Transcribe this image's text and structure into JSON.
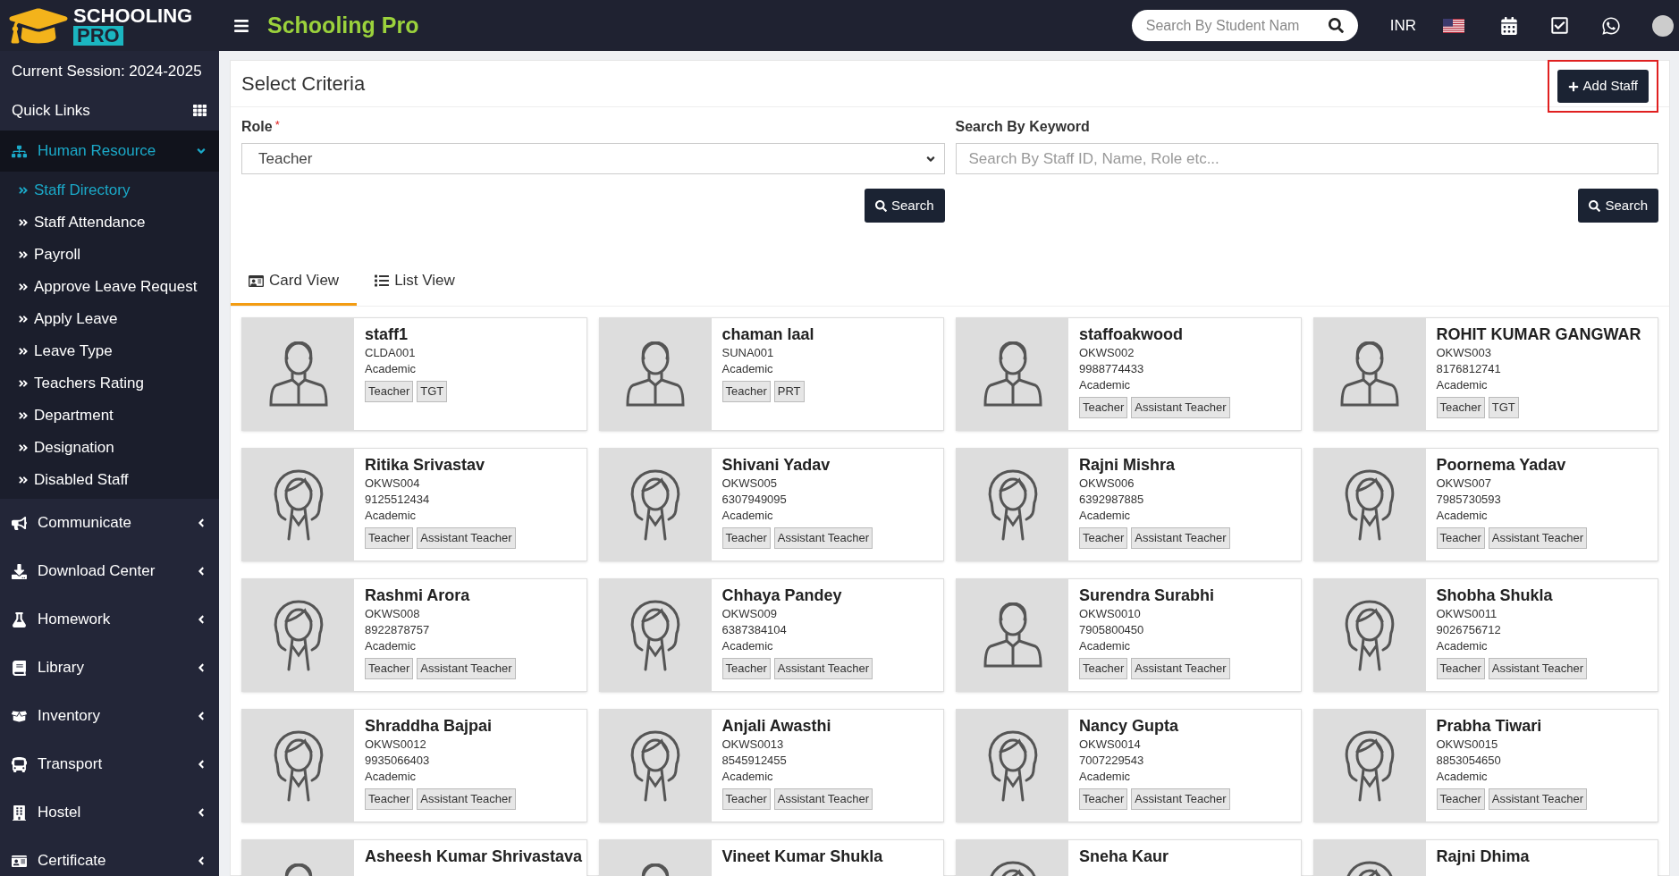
{
  "logo": {
    "top": "SCHOOLING",
    "bottom": "PRO"
  },
  "app_title": "Schooling Pro",
  "search": {
    "placeholder": "Search By Student Nam"
  },
  "currency": "INR",
  "sidebar": {
    "session": "Current Session: 2024-2025",
    "quick_links": "Quick Links",
    "sections": [
      {
        "label": "Human Resource",
        "expanded": true,
        "children": [
          {
            "label": "Staff Directory",
            "selected": true
          },
          {
            "label": "Staff Attendance",
            "selected": false
          },
          {
            "label": "Payroll",
            "selected": false
          },
          {
            "label": "Approve Leave Request",
            "selected": false
          },
          {
            "label": "Apply Leave",
            "selected": false
          },
          {
            "label": "Leave Type",
            "selected": false
          },
          {
            "label": "Teachers Rating",
            "selected": false
          },
          {
            "label": "Department",
            "selected": false
          },
          {
            "label": "Designation",
            "selected": false
          },
          {
            "label": "Disabled Staff",
            "selected": false
          }
        ]
      },
      {
        "label": "Communicate",
        "expanded": false
      },
      {
        "label": "Download Center",
        "expanded": false
      },
      {
        "label": "Homework",
        "expanded": false
      },
      {
        "label": "Library",
        "expanded": false
      },
      {
        "label": "Inventory",
        "expanded": false
      },
      {
        "label": "Transport",
        "expanded": false
      },
      {
        "label": "Hostel",
        "expanded": false
      },
      {
        "label": "Certificate",
        "expanded": false
      }
    ]
  },
  "panel": {
    "title": "Select Criteria",
    "add_button": "Add Staff",
    "role": {
      "label": "Role",
      "required_mark": "*",
      "value": "Teacher"
    },
    "keyword": {
      "label": "Search By Keyword",
      "placeholder": "Search By Staff ID, Name, Role etc..."
    },
    "search_buttons": [
      "Search",
      "Search"
    ],
    "tabs": [
      {
        "label": "Card View",
        "selected": true
      },
      {
        "label": "List View",
        "selected": false
      }
    ],
    "staff": [
      {
        "kind": "male",
        "name": "staff1",
        "lines": [
          "CLDA001",
          "Academic"
        ],
        "tags": [
          "Teacher",
          "TGT"
        ]
      },
      {
        "kind": "male",
        "name": "chaman laal",
        "lines": [
          "SUNA001",
          "Academic"
        ],
        "tags": [
          "Teacher",
          "PRT"
        ]
      },
      {
        "kind": "male",
        "name": "staffoakwood",
        "lines": [
          "OKWS002",
          "9988774433",
          "Academic"
        ],
        "tags": [
          "Teacher",
          "Assistant Teacher"
        ]
      },
      {
        "kind": "male",
        "name": "ROHIT KUMAR GANGWAR",
        "lines": [
          "OKWS003",
          "8176812741",
          "Academic"
        ],
        "tags": [
          "Teacher",
          "TGT"
        ]
      },
      {
        "kind": "female",
        "name": "Ritika Srivastav",
        "lines": [
          "OKWS004",
          "9125512434",
          "Academic"
        ],
        "tags": [
          "Teacher",
          "Assistant Teacher"
        ]
      },
      {
        "kind": "female",
        "name": "Shivani Yadav",
        "lines": [
          "OKWS005",
          "6307949095",
          "Academic"
        ],
        "tags": [
          "Teacher",
          "Assistant Teacher"
        ]
      },
      {
        "kind": "female",
        "name": "Rajni Mishra",
        "lines": [
          "OKWS006",
          "6392987885",
          "Academic"
        ],
        "tags": [
          "Teacher",
          "Assistant Teacher"
        ]
      },
      {
        "kind": "female",
        "name": "Poornema Yadav",
        "lines": [
          "OKWS007",
          "7985730593",
          "Academic"
        ],
        "tags": [
          "Teacher",
          "Assistant Teacher"
        ]
      },
      {
        "kind": "female",
        "name": "Rashmi Arora",
        "lines": [
          "OKWS008",
          "8922878757",
          "Academic"
        ],
        "tags": [
          "Teacher",
          "Assistant Teacher"
        ]
      },
      {
        "kind": "female",
        "name": "Chhaya Pandey",
        "lines": [
          "OKWS009",
          "6387384104",
          "Academic"
        ],
        "tags": [
          "Teacher",
          "Assistant Teacher"
        ]
      },
      {
        "kind": "male",
        "name": "Surendra Surabhi",
        "lines": [
          "OKWS0010",
          "7905800450",
          "Academic"
        ],
        "tags": [
          "Teacher",
          "Assistant Teacher"
        ]
      },
      {
        "kind": "female",
        "name": "Shobha Shukla",
        "lines": [
          "OKWS0011",
          "9026756712",
          "Academic"
        ],
        "tags": [
          "Teacher",
          "Assistant Teacher"
        ]
      },
      {
        "kind": "female",
        "name": "Shraddha Bajpai",
        "lines": [
          "OKWS0012",
          "9935066403",
          "Academic"
        ],
        "tags": [
          "Teacher",
          "Assistant Teacher"
        ]
      },
      {
        "kind": "female",
        "name": "Anjali Awasthi",
        "lines": [
          "OKWS0013",
          "8545912455",
          "Academic"
        ],
        "tags": [
          "Teacher",
          "Assistant Teacher"
        ]
      },
      {
        "kind": "female",
        "name": "Nancy Gupta",
        "lines": [
          "OKWS0014",
          "7007229543",
          "Academic"
        ],
        "tags": [
          "Teacher",
          "Assistant Teacher"
        ]
      },
      {
        "kind": "female",
        "name": "Prabha Tiwari",
        "lines": [
          "OKWS0015",
          "8853054650",
          "Academic"
        ],
        "tags": [
          "Teacher",
          "Assistant Teacher"
        ]
      },
      {
        "kind": "male",
        "name": "Asheesh Kumar Shrivastava"
      },
      {
        "kind": "male",
        "name": "Vineet Kumar Shukla"
      },
      {
        "kind": "female",
        "name": "Sneha Kaur"
      },
      {
        "kind": "female",
        "name": "Rajni Dhima"
      }
    ]
  }
}
